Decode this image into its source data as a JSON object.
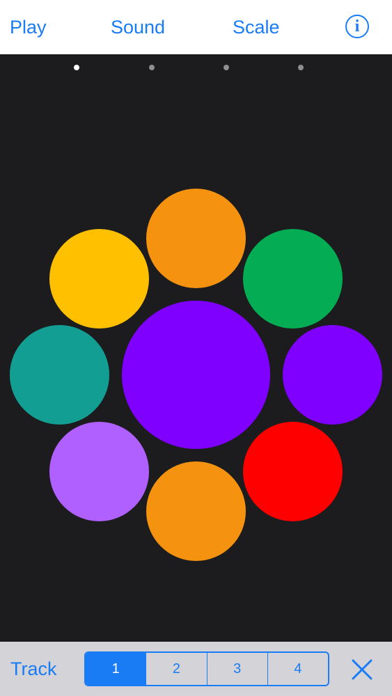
{
  "colors": {
    "accent": "#1a7cf5",
    "dot_active": "#ffffff",
    "dot_inactive": "#8e8e93"
  },
  "nav": {
    "play_label": "Play",
    "sound_label": "Sound",
    "scale_label": "Scale",
    "info_icon": "i"
  },
  "page_dots": {
    "count": 4,
    "active_index": 0
  },
  "pads": [
    {
      "name": "center-pad",
      "color": "#7f00ff"
    },
    {
      "name": "top-pad",
      "color": "#f59210"
    },
    {
      "name": "top-right-pad",
      "color": "#04ad53"
    },
    {
      "name": "right-pad",
      "color": "#8000ff"
    },
    {
      "name": "bottom-right-pad",
      "color": "#ff0000"
    },
    {
      "name": "bottom-pad",
      "color": "#f59210"
    },
    {
      "name": "bottom-left-pad",
      "color": "#b060ff"
    },
    {
      "name": "left-pad",
      "color": "#139e93"
    },
    {
      "name": "top-left-pad",
      "color": "#ffc000"
    }
  ],
  "bottom": {
    "track_label": "Track",
    "tracks": [
      "1",
      "2",
      "3",
      "4"
    ],
    "selected_track": "1",
    "close_icon": "close"
  }
}
